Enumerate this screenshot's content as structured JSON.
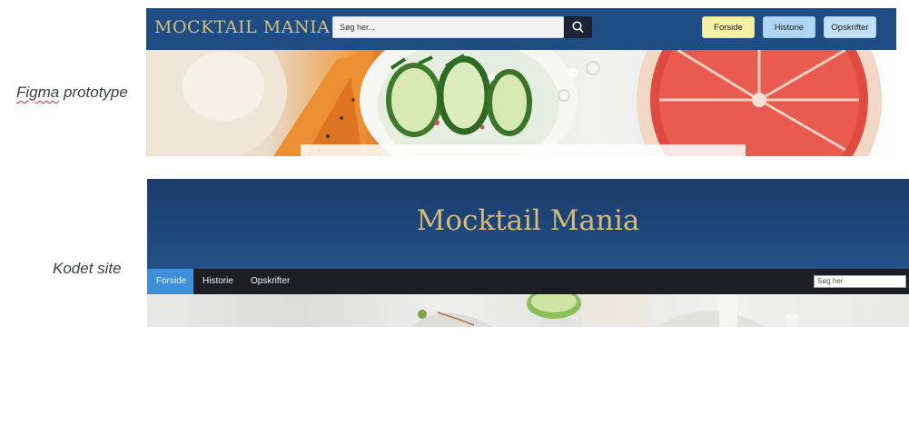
{
  "captions": {
    "figma_prefix": "Figma",
    "figma_suffix": " prototype",
    "kodet": "Kodet site"
  },
  "figma": {
    "logo": "MOCKTAIL MANIA",
    "search_placeholder": "Søg her...",
    "search_icon": "search-icon",
    "nav": [
      "Forside",
      "Historie",
      "Opskrifter"
    ],
    "colors": {
      "header": "#1f4c85",
      "logo": "#d7bf78",
      "forside": "#f6f1a2",
      "historie": "#aed6f2",
      "opskrifter": "#bfe0f6"
    },
    "hero_image": "mocktail-drinks-photo"
  },
  "kodet": {
    "title": "Mocktail Mania",
    "nav": [
      "Forside",
      "Historie",
      "Opskrifter"
    ],
    "search_placeholder": "Søg her",
    "colors": {
      "banner": "#1f4478",
      "title": "#d4bb78",
      "navbar": "#1c1f24",
      "active": "#3d8fd8"
    },
    "hero_image": "mocktail-table-photo"
  }
}
